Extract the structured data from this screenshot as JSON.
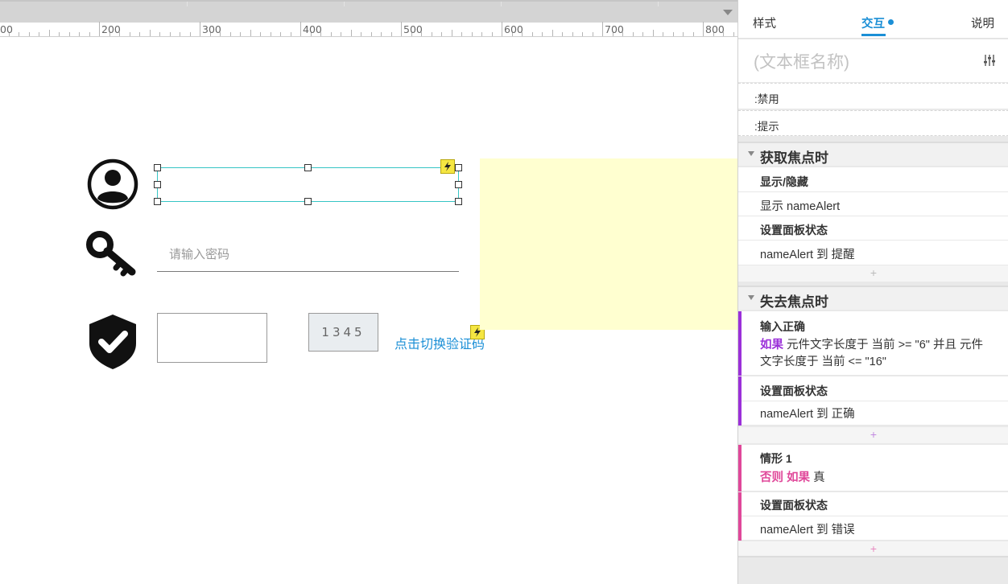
{
  "ruler": {
    "labels": [
      "00",
      "200",
      "300",
      "400",
      "500",
      "600",
      "700",
      "800"
    ]
  },
  "canvas": {
    "password_placeholder": "请输入密码",
    "captcha_text": "1345",
    "switch_link": "点击切换验证码"
  },
  "panel": {
    "tabs": {
      "style": "样式",
      "interact": "交互",
      "notes": "说明"
    },
    "name_placeholder": "(文本框名称)",
    "props": {
      "disabled": ":禁用",
      "hint": ":提示"
    },
    "focus": {
      "title": "获取焦点时",
      "act1_title": "显示/隐藏",
      "act1_value": "显示 nameAlert",
      "act2_title": "设置面板状态",
      "act2_value": "nameAlert 到 提醒",
      "plus": "+"
    },
    "blur": {
      "title": "失去焦点时",
      "case1": {
        "name": "输入正确",
        "if_kw": "如果",
        "cond_line1": "元件文字长度于 当前 >= \"6\" 并且 元件",
        "cond_line2": "文字长度于 当前 <= \"16\"",
        "act_title": "设置面板状态",
        "act_value": "nameAlert 到 正确",
        "plus": "+"
      },
      "case2": {
        "name": "情形 1",
        "else_kw": "否则 如果",
        "cond": "真",
        "act_title": "设置面板状态",
        "act_value": "nameAlert 到 错误",
        "plus": "+"
      }
    }
  },
  "colors": {
    "accent": "#1b8fd6",
    "case1_bar": "#9b30d9",
    "case2_bar": "#e0489a",
    "selection": "#36c5c5",
    "panel_fill": "#ffffd0"
  }
}
